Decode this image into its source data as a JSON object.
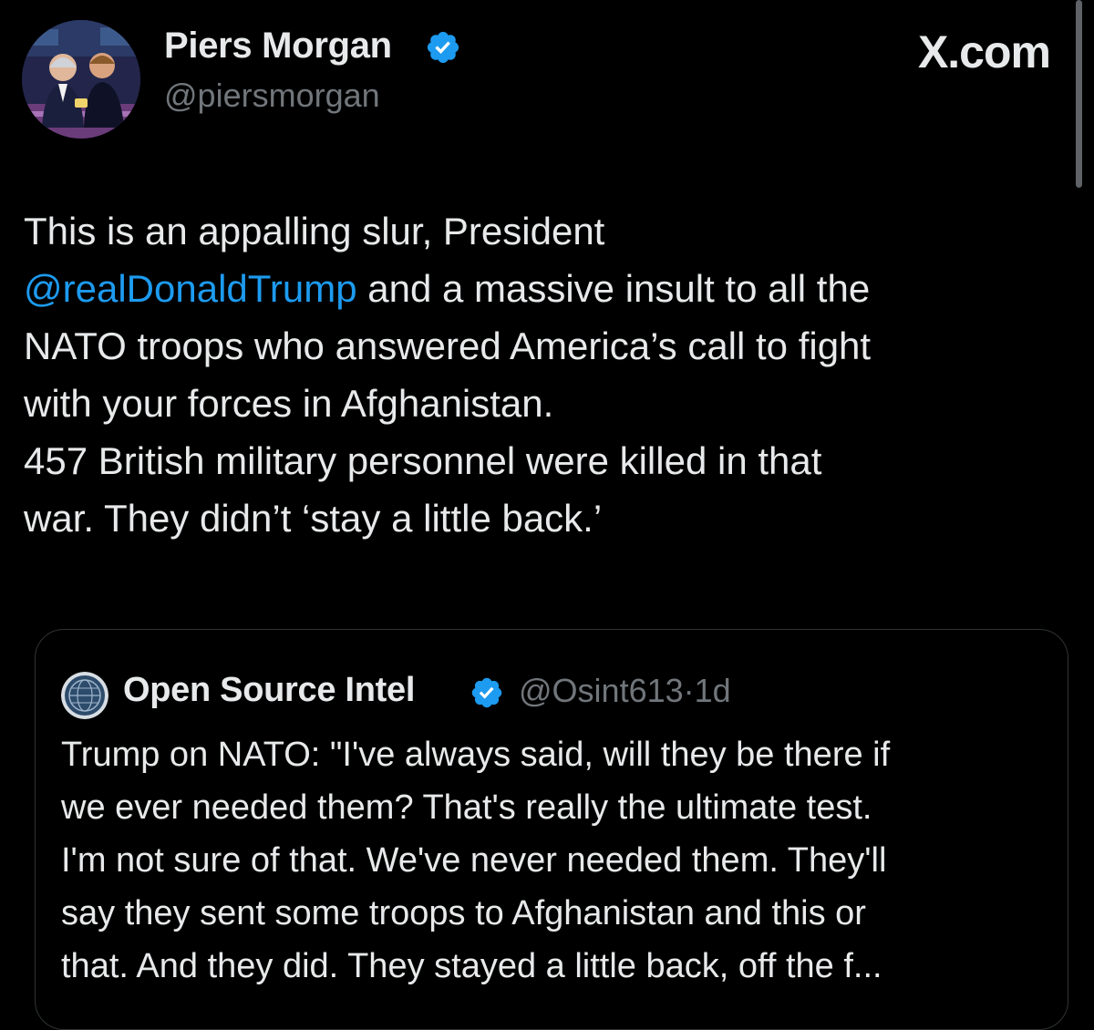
{
  "author": {
    "name": "Piers Morgan",
    "handle": "@piersmorgan",
    "verified": true
  },
  "site_label": "X.com",
  "tweet": {
    "lines": [
      {
        "text": "This is an appalling slur, President",
        "mention": ""
      },
      {
        "text": " and a massive insult to all the",
        "mention": "@realDonaldTrump"
      },
      {
        "text": "NATO troops who answered America’s call to fight",
        "mention": ""
      },
      {
        "text": "with your forces in Afghanistan.",
        "mention": ""
      },
      {
        "text": "457 British military personnel were killed in that",
        "mention": ""
      },
      {
        "text": "war. They didn’t ‘stay a little back.’",
        "mention": ""
      }
    ]
  },
  "quoted_tweet": {
    "name": "Open Source Intel",
    "handle": "@Osint613",
    "separator": "·",
    "time": "1d",
    "verified": true,
    "lines": [
      "Trump on NATO: \"I've always said, will they be there if",
      "we ever needed them? That's really the ultimate test.",
      "I'm not sure of that. We've never needed them. They'll",
      "say they sent some troops to Afghanistan and this or",
      "that. And they did. They stayed a little back, off the f..."
    ]
  },
  "colors": {
    "background": "#000000",
    "text": "#e7e9ea",
    "secondary_text": "#71767b",
    "link": "#1d9bf0",
    "verified_badge": "#1d9bf0",
    "border": "#2f3336"
  },
  "icons": {
    "verified": "verified-badge-icon"
  }
}
